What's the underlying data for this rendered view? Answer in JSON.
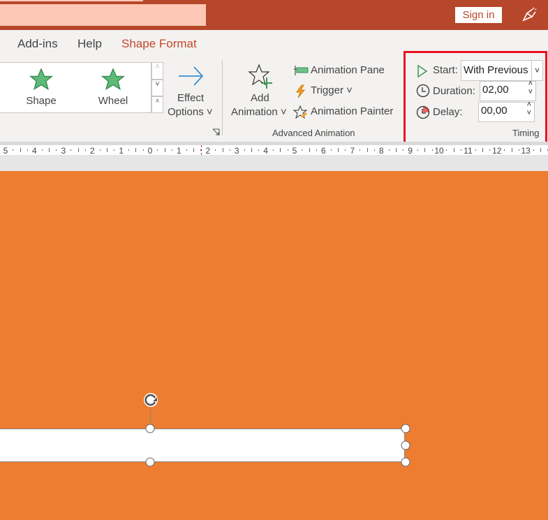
{
  "titlebar": {
    "sign_in": "Sign in",
    "feedback_icon": "feedback-icon"
  },
  "tabs": [
    {
      "label": "Add-ins"
    },
    {
      "label": "Help"
    },
    {
      "label": "Shape Format",
      "active": true
    }
  ],
  "colors": {
    "title_bar": "#b7472a",
    "active_tab": "#c4472b",
    "slide_background": "#ed7d31",
    "highlight": "#e81123"
  },
  "animation_gallery": {
    "items": [
      {
        "label": "Shape",
        "icon": "star-icon"
      },
      {
        "label": "Wheel",
        "icon": "star-icon"
      }
    ]
  },
  "effect_options": {
    "line1": "Effect",
    "line2": "Options"
  },
  "advanced_animation": {
    "add_line1": "Add",
    "add_line2": "Animation",
    "animation_pane": "Animation Pane",
    "trigger": "Trigger",
    "animation_painter": "Animation Painter",
    "group_label": "Advanced Animation"
  },
  "timing": {
    "start_label": "Start:",
    "start_value": "With Previous",
    "duration_label": "Duration:",
    "duration_value": "02,00",
    "delay_label": "Delay:",
    "delay_value": "00,00",
    "group_label": "Timing"
  },
  "ruler": {
    "labels": [
      "5",
      "4",
      "3",
      "2",
      "1",
      "0",
      "1",
      "2",
      "3",
      "4",
      "5",
      "6",
      "7",
      "8",
      "9",
      "10",
      "11",
      "12",
      "13"
    ]
  }
}
